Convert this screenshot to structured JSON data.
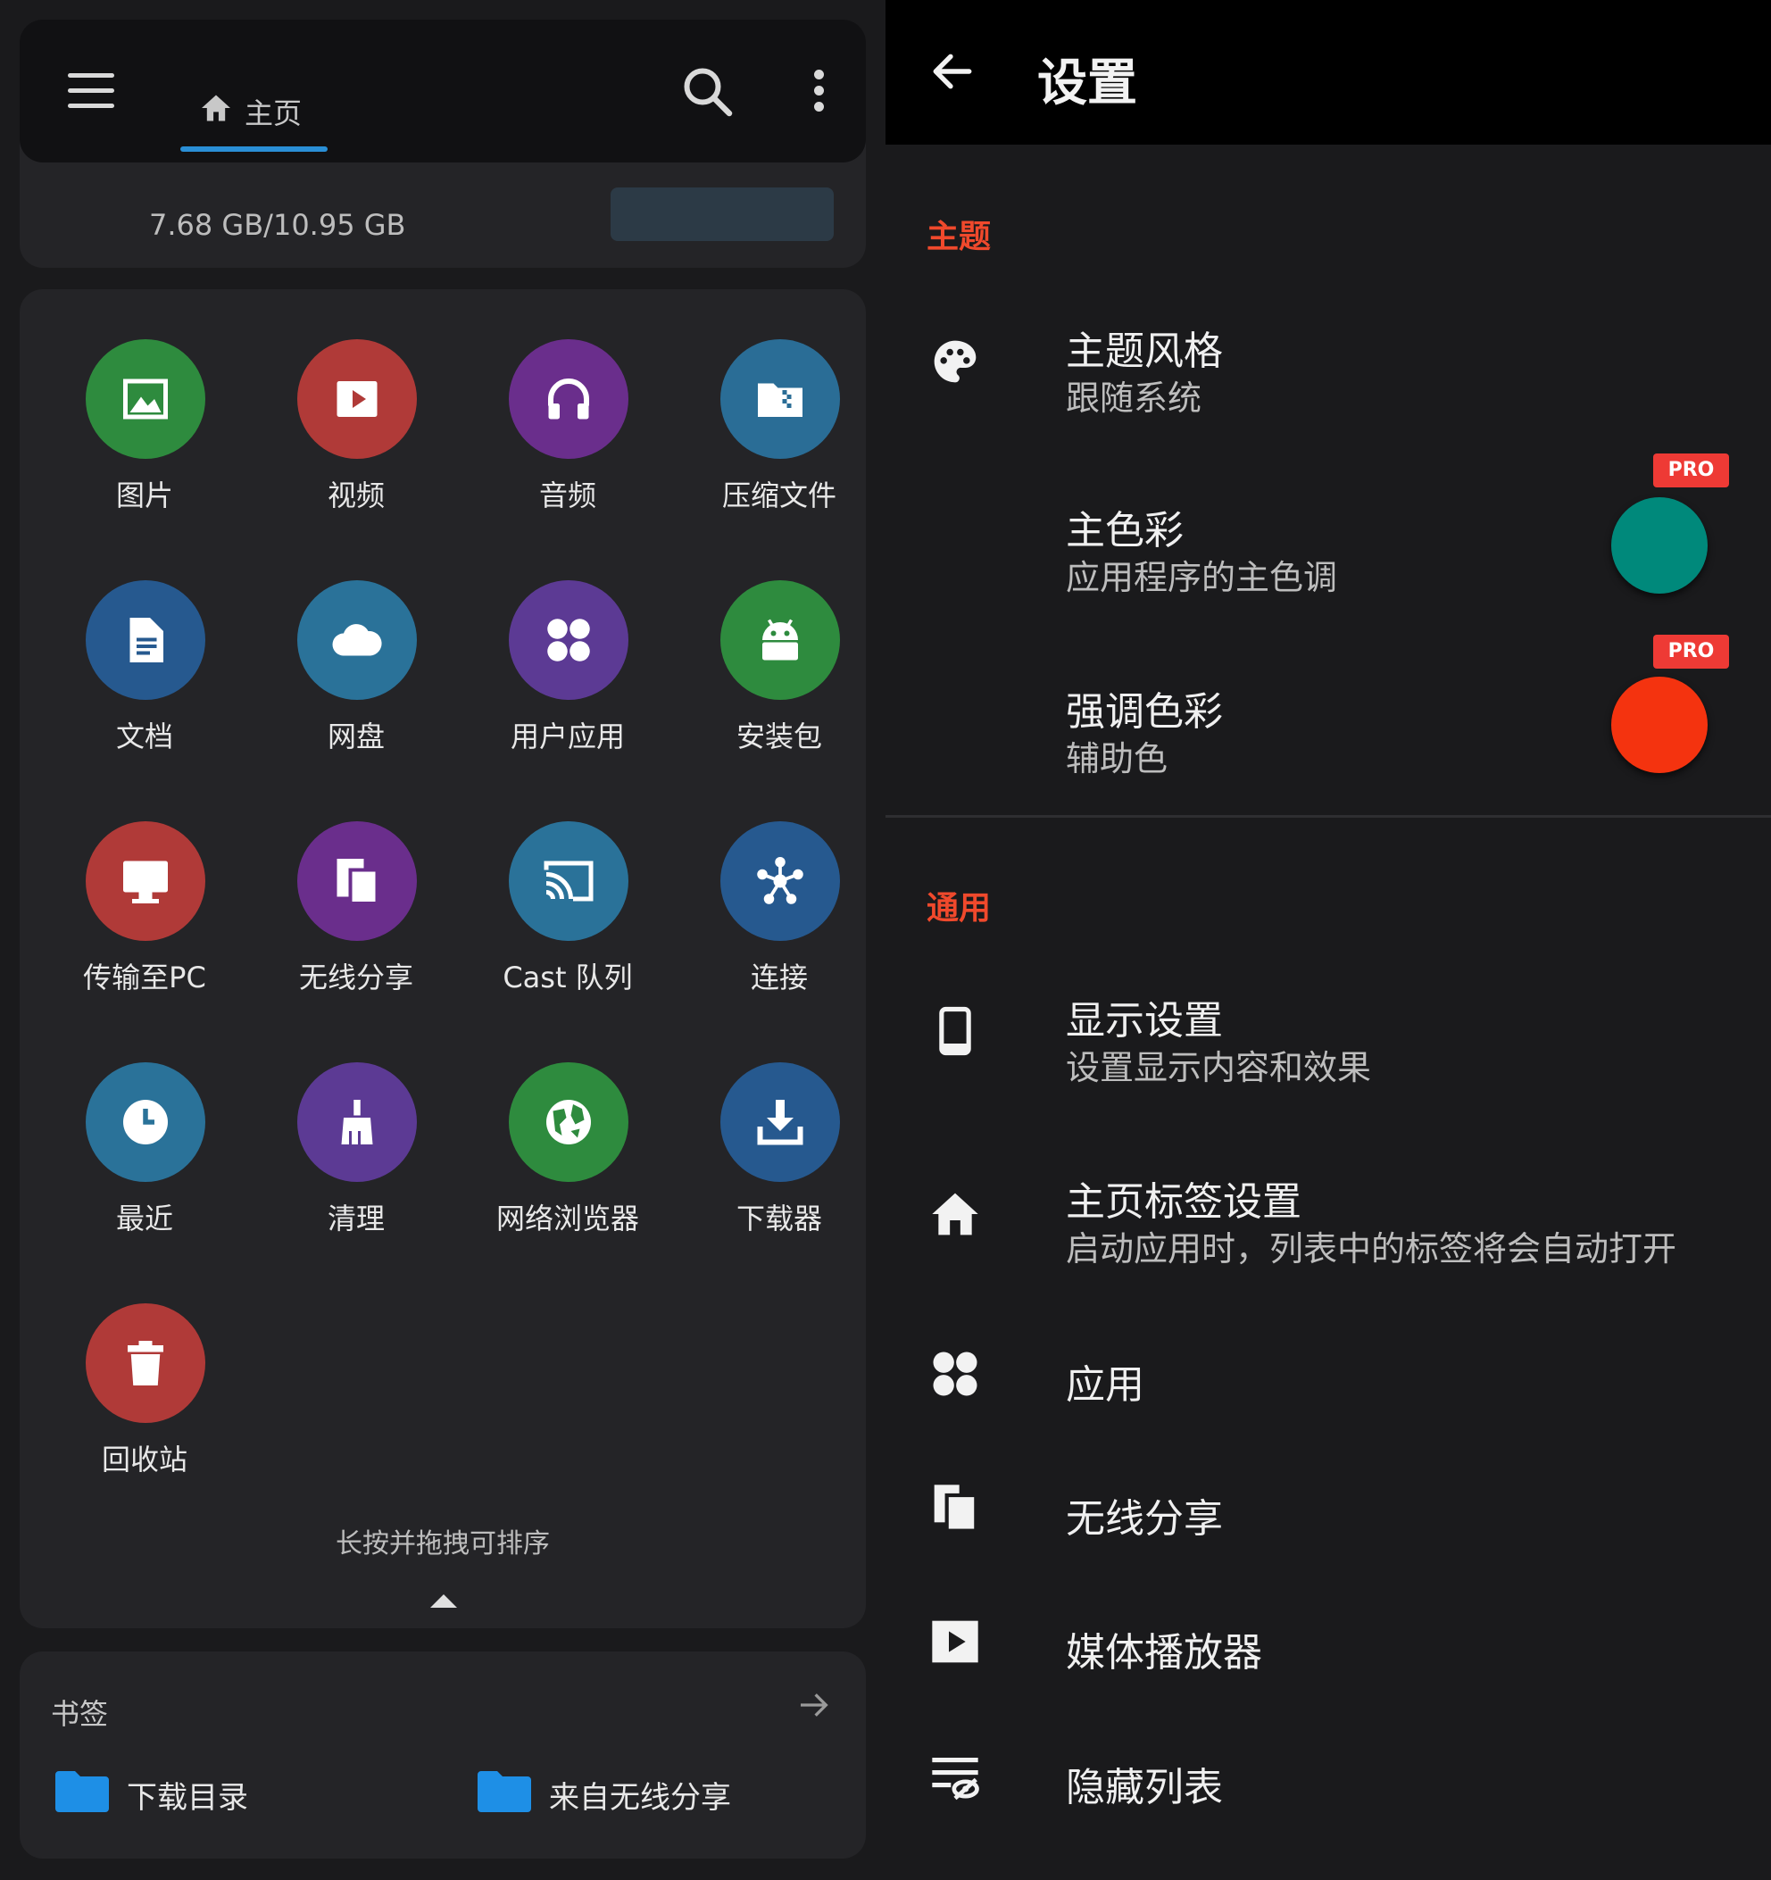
{
  "left": {
    "topbar": {
      "tab_label": "主页"
    },
    "storage": {
      "size_text": "7.68 GB/10.95 GB"
    },
    "categories": [
      {
        "label": "图片",
        "icon": "image-icon",
        "color": "#2e8b3e"
      },
      {
        "label": "视频",
        "icon": "play-icon",
        "color": "#b03a38"
      },
      {
        "label": "音频",
        "icon": "headphones-icon",
        "color": "#6a2e8c"
      },
      {
        "label": "压缩文件",
        "icon": "archive-icon",
        "color": "#2a6d96"
      },
      {
        "label": "文档",
        "icon": "document-icon",
        "color": "#26598f"
      },
      {
        "label": "网盘",
        "icon": "cloud-icon",
        "color": "#2a7299"
      },
      {
        "label": "用户应用",
        "icon": "apps-icon",
        "color": "#5c3a94"
      },
      {
        "label": "安装包",
        "icon": "android-icon",
        "color": "#2e8b3e"
      },
      {
        "label": "传输至PC",
        "icon": "monitor-icon",
        "color": "#b03a38"
      },
      {
        "label": "无线分享",
        "icon": "share-icon",
        "color": "#6a2e8c"
      },
      {
        "label": "Cast 队列",
        "icon": "cast-icon",
        "color": "#2a7299"
      },
      {
        "label": "连接",
        "icon": "network-icon",
        "color": "#26598f"
      },
      {
        "label": "最近",
        "icon": "clock-icon",
        "color": "#2a7299"
      },
      {
        "label": "清理",
        "icon": "broom-icon",
        "color": "#5c3a94"
      },
      {
        "label": "网络浏览器",
        "icon": "globe-icon",
        "color": "#2e8b3e"
      },
      {
        "label": "下载器",
        "icon": "download-icon",
        "color": "#26598f"
      },
      {
        "label": "回收站",
        "icon": "trash-icon",
        "color": "#b03a38"
      }
    ],
    "hint": "长按并拖拽可排序",
    "bookmarks": {
      "title": "书签",
      "items": [
        {
          "label": "下载目录"
        },
        {
          "label": "来自无线分享"
        }
      ]
    }
  },
  "right": {
    "title": "设置",
    "sections": {
      "theme": {
        "title": "主题",
        "style": {
          "title": "主题风格",
          "subtitle": "跟随系统"
        },
        "primary": {
          "title": "主色彩",
          "subtitle": "应用程序的主色调",
          "badge": "PRO",
          "color": "#00897b"
        },
        "accent": {
          "title": "强调色彩",
          "subtitle": "辅助色",
          "badge": "PRO",
          "color": "#f4330f"
        }
      },
      "general": {
        "title": "通用",
        "display": {
          "title": "显示设置",
          "subtitle": "设置显示内容和效果"
        },
        "home_tabs": {
          "title": "主页标签设置",
          "subtitle": "启动应用时，列表中的标签将会自动打开"
        },
        "apps": {
          "title": "应用"
        },
        "wireless": {
          "title": "无线分享"
        },
        "media": {
          "title": "媒体播放器"
        },
        "hidden": {
          "title": "隐藏列表"
        }
      }
    }
  }
}
